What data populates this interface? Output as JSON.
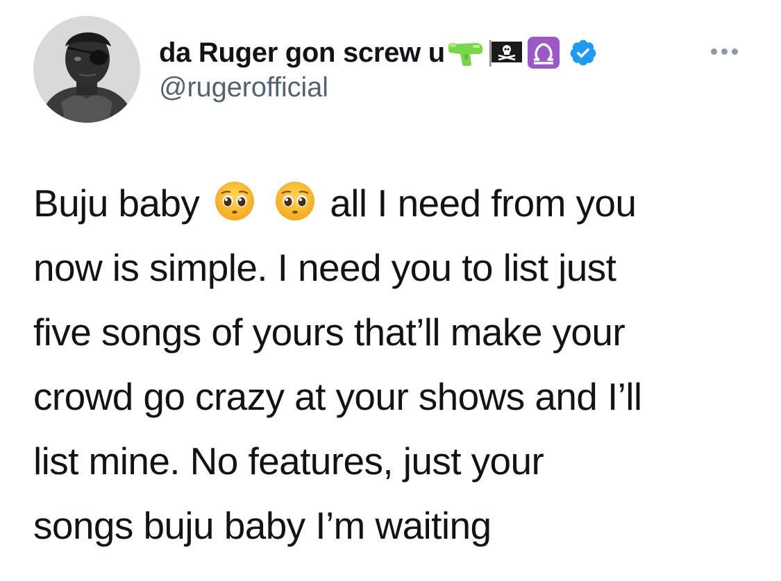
{
  "author": {
    "display_name": "da Ruger gon screw u",
    "name_emojis": [
      "water-pistol-emoji",
      "pirate-flag-emoji",
      "libra-emoji"
    ],
    "verified": true,
    "handle": "@rugerofficial"
  },
  "more_menu": {
    "icon": "more-horizontal-icon"
  },
  "tweet": {
    "line1_before": "Buju baby",
    "line1_emojis": [
      "pleading-face-emoji",
      "pleading-face-emoji"
    ],
    "line1_after": "all I need from you",
    "line2": "now is simple. I need you to list just",
    "line3": "five songs of yours that’ll make your",
    "line4": "crowd go crazy at your shows and I’ll",
    "line5": "list mine. No features, just your",
    "line6": "songs buju baby I’m waiting"
  },
  "colors": {
    "text": "#0f1419",
    "secondary_text": "#536471",
    "verified_blue": "#1d9bf0"
  }
}
